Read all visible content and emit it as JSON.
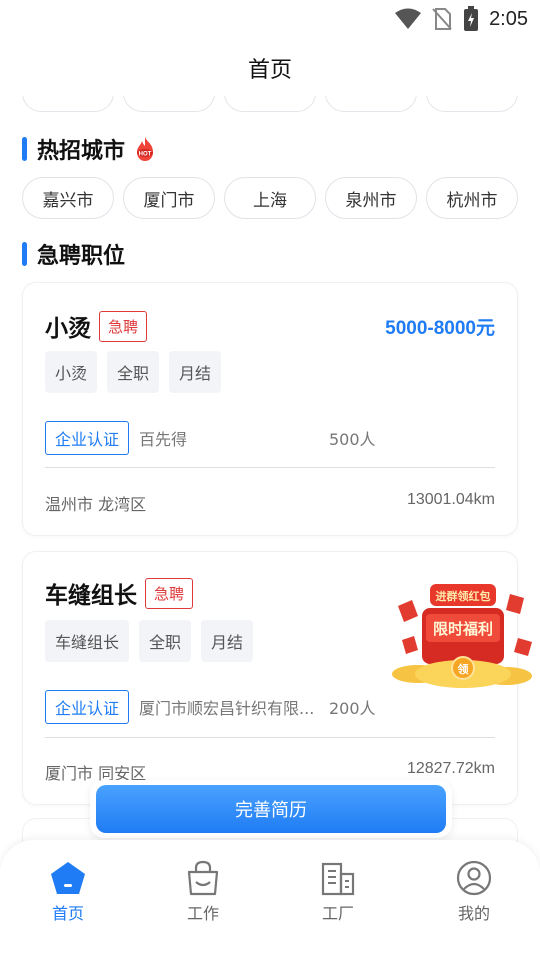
{
  "status": {
    "time": "2:05"
  },
  "header": {
    "title": "首页"
  },
  "hot_cities": {
    "title": "热招城市",
    "badge": "HOT",
    "cities": [
      "嘉兴市",
      "厦门市",
      "上海",
      "泉州市",
      "杭州市"
    ]
  },
  "urgent_jobs": {
    "title": "急聘职位",
    "jobs": [
      {
        "title": "小烫",
        "urgent": "急聘",
        "salary": "5000-8000元",
        "tags": [
          "小烫",
          "全职",
          "月结"
        ],
        "verify": "企业认证",
        "company": "百先得",
        "size": "500人",
        "location": "温州市 龙湾区",
        "distance": "13001.04km"
      },
      {
        "title": "车缝组长",
        "urgent": "急聘",
        "salary": "",
        "tags": [
          "车缝组长",
          "全职",
          "月结"
        ],
        "verify": "企业认证",
        "company": "厦门市顺宏昌针织有限...",
        "size": "200人",
        "location": "厦门市 同安区",
        "distance": "12827.72km"
      }
    ]
  },
  "promo": {
    "top_text": "进群领红包",
    "main_text": "限时福利",
    "coin_text": "领"
  },
  "resume_button": "完善简历",
  "tabs": [
    {
      "label": "首页",
      "icon": "home-icon",
      "active": true
    },
    {
      "label": "工作",
      "icon": "bag-icon",
      "active": false
    },
    {
      "label": "工厂",
      "icon": "building-icon",
      "active": false
    },
    {
      "label": "我的",
      "icon": "user-icon",
      "active": false
    }
  ],
  "colors": {
    "accent": "#1f7cf4",
    "urgent": "#e0393a"
  }
}
